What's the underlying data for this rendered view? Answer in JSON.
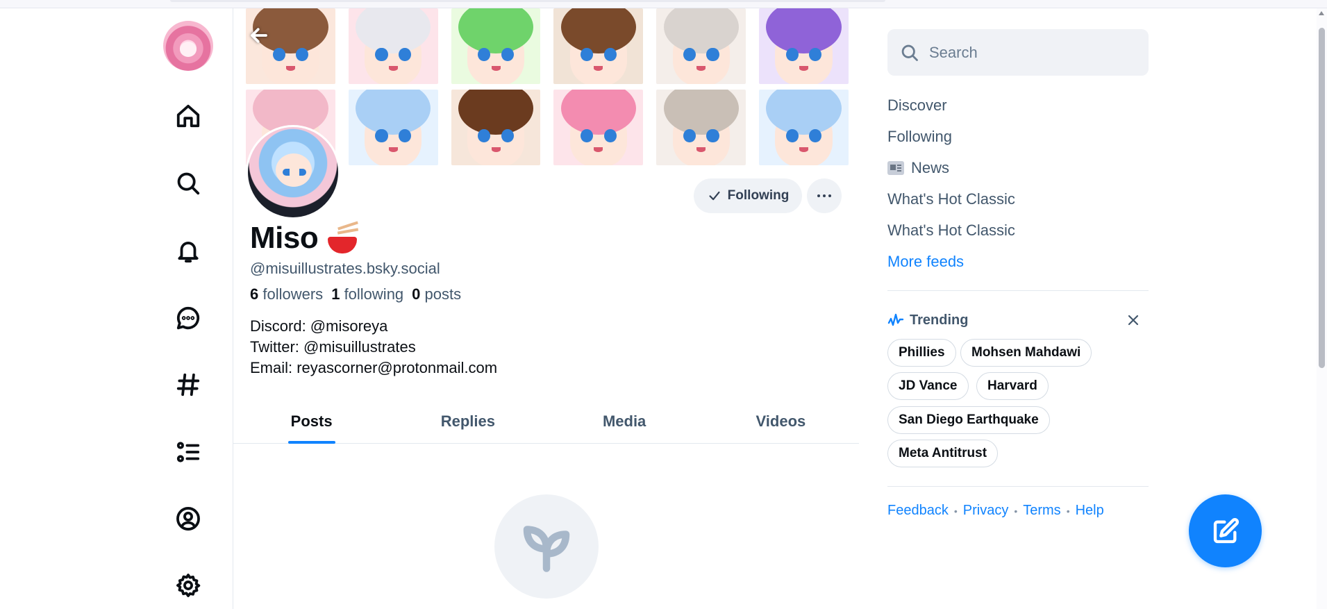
{
  "profile": {
    "display_name": "Miso",
    "handle": "@misuillustrates.bsky.social",
    "followers_count": "6",
    "followers_label": "followers",
    "following_count": "1",
    "following_label": "following",
    "posts_count": "0",
    "posts_label": "posts",
    "bio_lines": [
      "Discord: @misoreya",
      "Twitter: @misuillustrates",
      "Email: reyascorner@protonmail.com"
    ],
    "following_button": "Following"
  },
  "tabs": [
    {
      "label": "Posts",
      "active": true
    },
    {
      "label": "Replies",
      "active": false
    },
    {
      "label": "Media",
      "active": false
    },
    {
      "label": "Videos",
      "active": false
    }
  ],
  "search": {
    "placeholder": "Search"
  },
  "feeds": [
    {
      "label": "Discover"
    },
    {
      "label": "Following"
    },
    {
      "label": "News"
    },
    {
      "label": "What's Hot Classic"
    },
    {
      "label": "What's Hot Classic"
    },
    {
      "label": "More feeds"
    }
  ],
  "trending": {
    "title": "Trending",
    "topics": [
      "Phillies",
      "Mohsen Mahdawi",
      "JD Vance",
      "Harvard",
      "San Diego Earthquake",
      "Meta Antitrust"
    ]
  },
  "footer": {
    "links": [
      "Feedback",
      "Privacy",
      "Terms",
      "Help"
    ]
  },
  "nav_icons": [
    "home-icon",
    "search-icon",
    "bell-icon",
    "chat-icon",
    "hashtag-icon",
    "lists-icon",
    "profile-icon",
    "settings-icon"
  ],
  "banner_palette": [
    [
      "#fbe7dc",
      "#8b5a3c"
    ],
    [
      "#fde4ea",
      "#e8e8ee"
    ],
    [
      "#eafbe0",
      "#6fd36b"
    ],
    [
      "#f1e3d6",
      "#7a4a2b"
    ],
    [
      "#f4eeea",
      "#d9d3cf"
    ],
    [
      "#ece2fb",
      "#8f63d8"
    ],
    [
      "#fde4ea",
      "#f2b8c8"
    ],
    [
      "#e6f2fe",
      "#a9cff5"
    ],
    [
      "#f6e6da",
      "#6b3b1f"
    ],
    [
      "#fde4ea",
      "#f38cb0"
    ],
    [
      "#f4eeea",
      "#c9bfb6"
    ],
    [
      "#e6f2fe",
      "#a9cff5"
    ]
  ],
  "colors": {
    "accent": "#1083fe",
    "muted": "#42576c"
  }
}
